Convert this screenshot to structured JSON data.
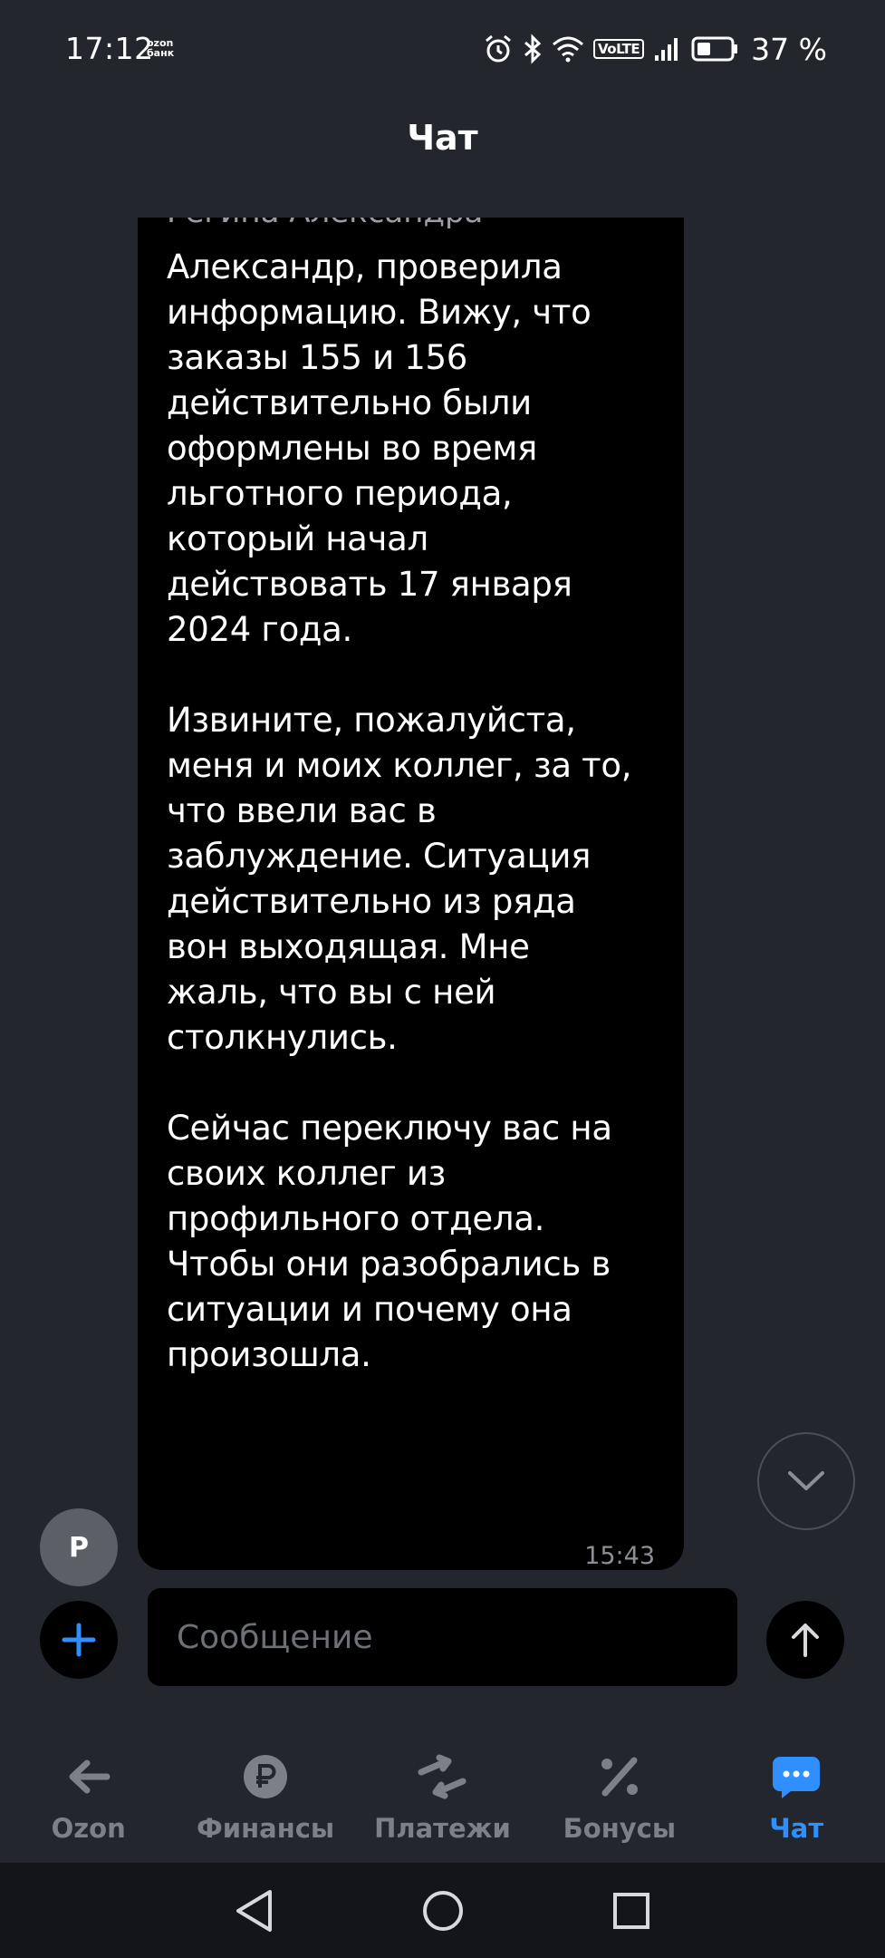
{
  "status_bar": {
    "time": "17:12",
    "carrier_logo_line1": "ozon",
    "carrier_logo_line2": "банк",
    "volte": "VoLTE",
    "battery_percent": "37 %",
    "icons": [
      "alarm-icon",
      "bluetooth-icon",
      "wifi-icon",
      "volte-icon",
      "signal-icon",
      "battery-icon"
    ]
  },
  "header": {
    "title": "Чат"
  },
  "chat": {
    "sender_name": "Регина Александра",
    "message_paragraphs": [
      "Александр, проверила информацию. Вижу, что заказы 155 и 156 действительно были оформлены во время льготного периода, который начал действовать 17 января 2024 года.",
      "Извините, пожалуйста, меня и моих коллег, за то, что ввели вас в заблуждение. Ситуация действительно из ряда вон выходящая. Мне жаль, что вы с ней столкнулись.",
      "Сейчас переключу вас на своих коллег из профильного отдела. Чтобы они разобрались в ситуации и почему она произошла."
    ],
    "message_time": "15:43",
    "avatar_letter": "Р"
  },
  "composer": {
    "placeholder": "Сообщение"
  },
  "nav": {
    "items": [
      {
        "label": "Ozon",
        "icon": "arrow-left-icon",
        "active": false
      },
      {
        "label": "Финансы",
        "icon": "ruble-icon",
        "active": false
      },
      {
        "label": "Платежи",
        "icon": "transfer-arrows-icon",
        "active": false
      },
      {
        "label": "Бонусы",
        "icon": "percent-icon",
        "active": false
      },
      {
        "label": "Чат",
        "icon": "chat-bubble-icon",
        "active": true
      }
    ]
  },
  "colors": {
    "background": "#23262d",
    "bubble": "#000000",
    "accent": "#2f8fff",
    "inactive_nav": "#7c8087",
    "system_nav": "#141519"
  }
}
